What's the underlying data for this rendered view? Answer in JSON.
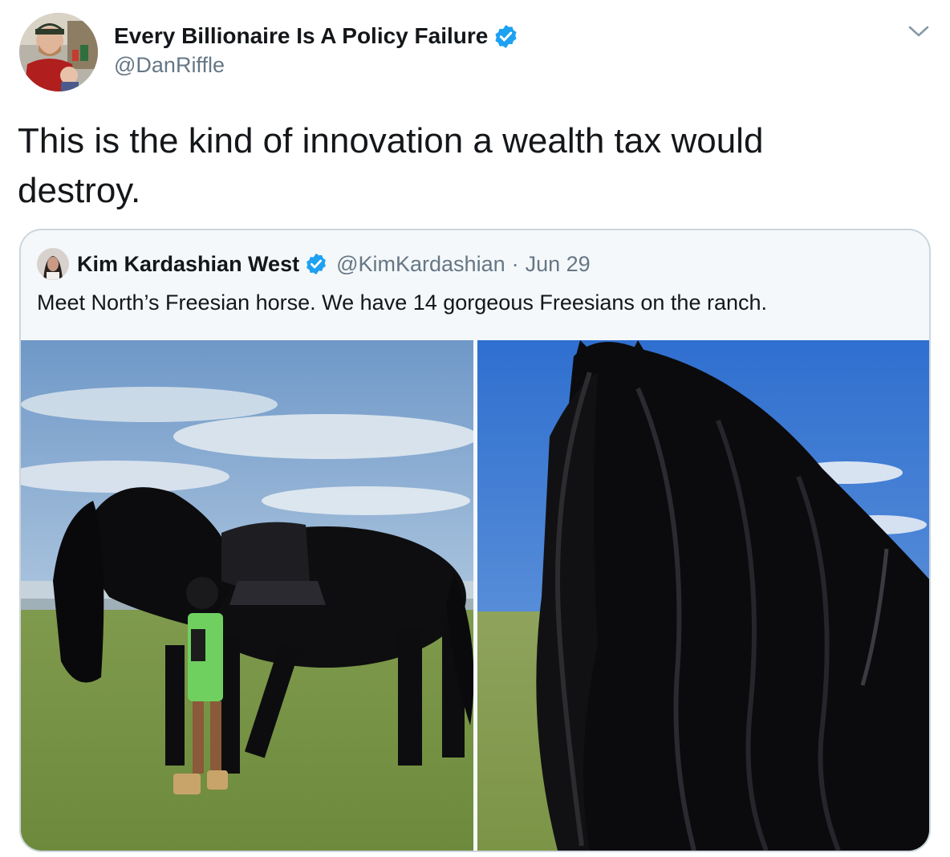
{
  "tweet": {
    "author_name": "Every Billionaire Is A Policy Failure",
    "author_handle": "@DanRiffle",
    "text_line1": "This is the kind of innovation a wealth tax would",
    "text_line2": "destroy.",
    "verified_icon": "verified-badge-icon",
    "menu_icon": "chevron-down-icon"
  },
  "quoted_tweet": {
    "author_name": "Kim Kardashian West",
    "author_handle": "@KimKardashian",
    "separator": "·",
    "date": "Jun 29",
    "text": "Meet North’s Freesian horse. We have 14 gorgeous Freesians on the ranch.",
    "photos": [
      {
        "icon": "photo-horse-with-child-icon"
      },
      {
        "icon": "photo-horse-mane-closeup-icon"
      }
    ]
  },
  "colors": {
    "text": "#14171a",
    "secondary": "#657786",
    "verified": "#1da1f2",
    "border": "#ccd6dd"
  }
}
